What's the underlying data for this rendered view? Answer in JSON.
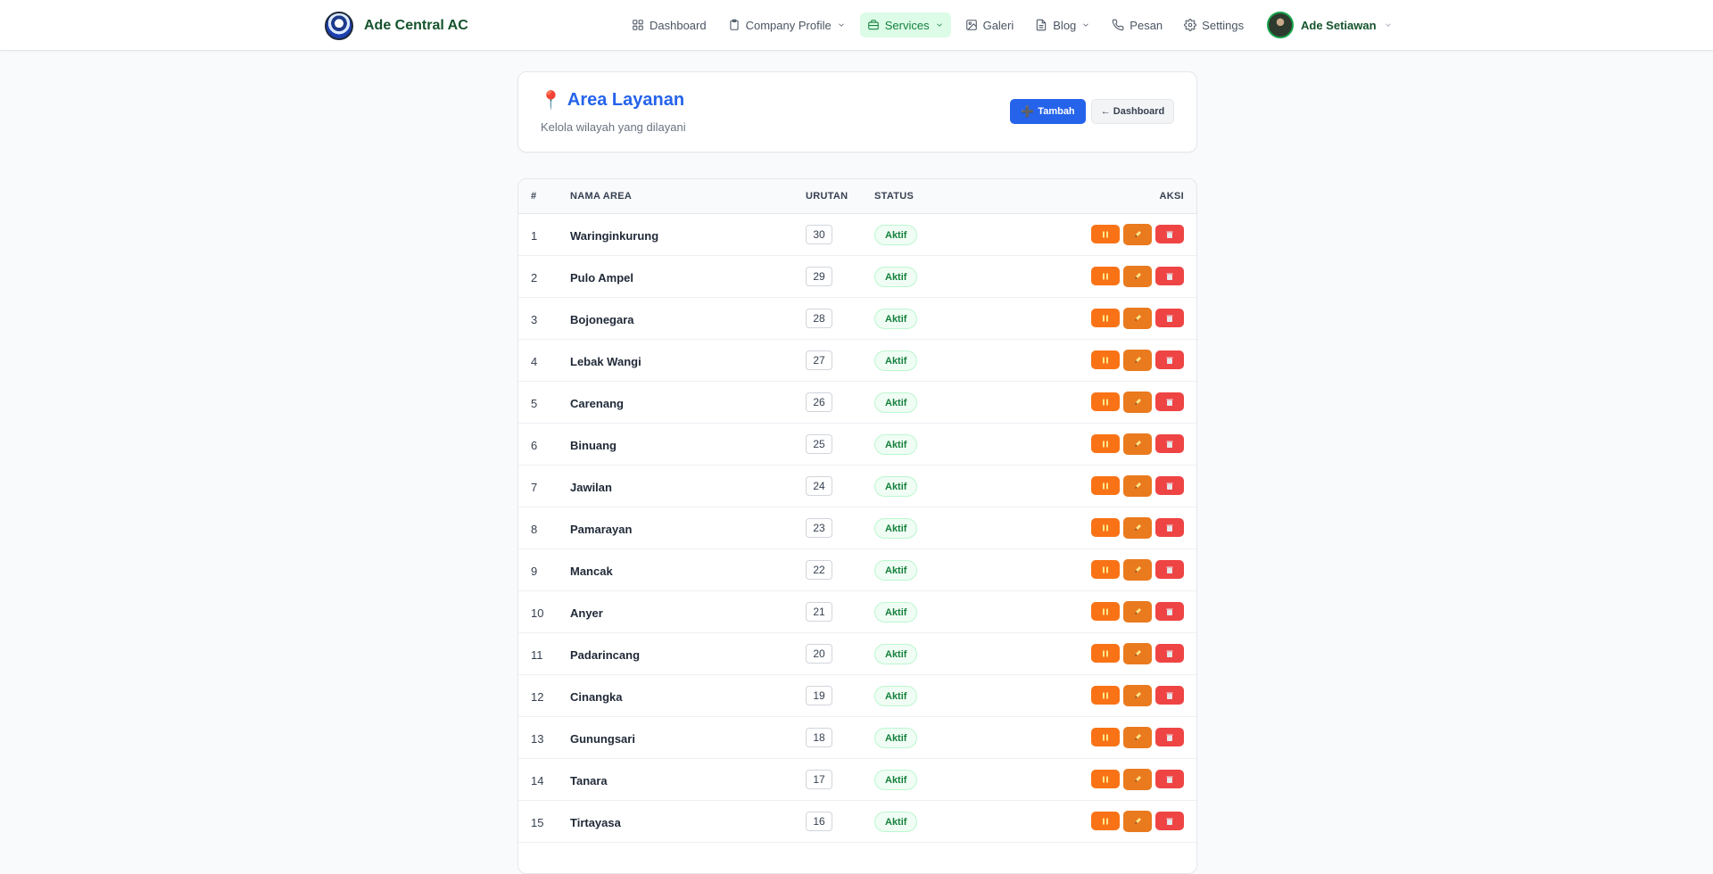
{
  "brand": {
    "name": "Ade Central AC"
  },
  "nav": {
    "items": [
      {
        "label": "Dashboard",
        "icon": "grid-icon",
        "dropdown": false,
        "active": false
      },
      {
        "label": "Company Profile",
        "icon": "clipboard-icon",
        "dropdown": true,
        "active": false
      },
      {
        "label": "Services",
        "icon": "briefcase-icon",
        "dropdown": true,
        "active": true
      },
      {
        "label": "Galeri",
        "icon": "image-icon",
        "dropdown": false,
        "active": false
      },
      {
        "label": "Blog",
        "icon": "document-icon",
        "dropdown": true,
        "active": false
      },
      {
        "label": "Pesan",
        "icon": "phone-icon",
        "dropdown": false,
        "active": false
      },
      {
        "label": "Settings",
        "icon": "gear-icon",
        "dropdown": false,
        "active": false
      }
    ]
  },
  "user": {
    "name": "Ade Setiawan"
  },
  "header": {
    "icon": "📍",
    "title": "Area Layanan",
    "subtitle": "Kelola wilayah yang dilayani",
    "add_label": "Tambah",
    "add_icon": "➕",
    "back_label": "← Dashboard"
  },
  "table": {
    "headers": {
      "no": "#",
      "name": "NAMA AREA",
      "order": "URUTAN",
      "status": "STATUS",
      "actions": "AKSI"
    },
    "rows": [
      {
        "no": "1",
        "name": "Waringinkurung",
        "order": "30",
        "status": "Aktif"
      },
      {
        "no": "2",
        "name": "Pulo Ampel",
        "order": "29",
        "status": "Aktif"
      },
      {
        "no": "3",
        "name": "Bojonegara",
        "order": "28",
        "status": "Aktif"
      },
      {
        "no": "4",
        "name": "Lebak Wangi",
        "order": "27",
        "status": "Aktif"
      },
      {
        "no": "5",
        "name": "Carenang",
        "order": "26",
        "status": "Aktif"
      },
      {
        "no": "6",
        "name": "Binuang",
        "order": "25",
        "status": "Aktif"
      },
      {
        "no": "7",
        "name": "Jawilan",
        "order": "24",
        "status": "Aktif"
      },
      {
        "no": "8",
        "name": "Pamarayan",
        "order": "23",
        "status": "Aktif"
      },
      {
        "no": "9",
        "name": "Mancak",
        "order": "22",
        "status": "Aktif"
      },
      {
        "no": "10",
        "name": "Anyer",
        "order": "21",
        "status": "Aktif"
      },
      {
        "no": "11",
        "name": "Padarincang",
        "order": "20",
        "status": "Aktif"
      },
      {
        "no": "12",
        "name": "Cinangka",
        "order": "19",
        "status": "Aktif"
      },
      {
        "no": "13",
        "name": "Gunungsari",
        "order": "18",
        "status": "Aktif"
      },
      {
        "no": "14",
        "name": "Tanara",
        "order": "17",
        "status": "Aktif"
      },
      {
        "no": "15",
        "name": "Tirtayasa",
        "order": "16",
        "status": "Aktif"
      }
    ]
  },
  "colors": {
    "brand_green": "#14532d",
    "primary_blue": "#2563eb",
    "active_nav_bg": "#dcfce7",
    "pause_button": "#f97316",
    "edit_button": "#ea7a1e",
    "delete_button": "#ef4444"
  }
}
